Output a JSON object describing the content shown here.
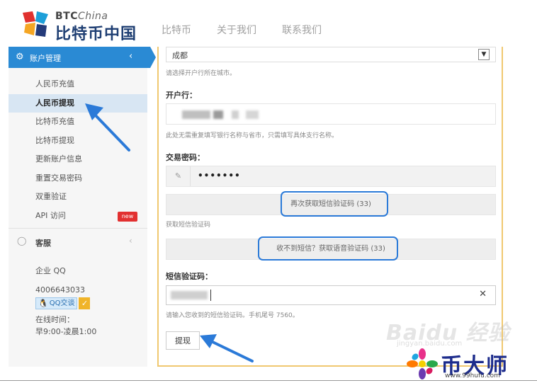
{
  "header": {
    "logo_btc": "BTC",
    "logo_china": "China",
    "logo_cn": "比特币中国",
    "nav": [
      "比特币",
      "关于我们",
      "联系我们"
    ]
  },
  "sidebar": {
    "section_title": "账户管理",
    "items": [
      {
        "label": "人民币充值"
      },
      {
        "label": "人民币提现",
        "active": true
      },
      {
        "label": "比特币充值"
      },
      {
        "label": "比特币提现"
      },
      {
        "label": "更新账户信息"
      },
      {
        "label": "重置交易密码"
      },
      {
        "label": "双重验证"
      },
      {
        "label": "API 访问",
        "badge": "new"
      }
    ],
    "service_title": "客服",
    "service": {
      "qq_label": "企业 QQ",
      "qq_number": "4006643033",
      "qq_button": "QQ交谈",
      "hours_label": "在线时间：",
      "hours": "早9:00-凌晨1:00"
    }
  },
  "form": {
    "city_value": "成都",
    "city_hint": "请选择开户行所在城市。",
    "bank_label": "开户行：",
    "bank_hint": "此处无需重复填写银行名称与省市，只需填写具体支行名称。",
    "password_label": "交易密码：",
    "password_value": "•••••••",
    "resend_sms_button": "再次获取短信验证码 (33)",
    "sms_hint": "获取短信验证码",
    "voice_button": "收不到短信？获取语音验证码 (33)",
    "code_label": "短信验证码：",
    "code_hint": "请输入您收到的短信验证码。手机尾号 7560。",
    "submit_label": "提现"
  },
  "watermarks": {
    "baidu": "Baidu 经验",
    "baidu_sub": "jingyan.baidu.com",
    "brand": "币大师",
    "brand_url": "www.99hufu.com"
  },
  "colors": {
    "accent": "#2a8ad4",
    "highlight": "#2b7ad8",
    "form_border": "#f0c870",
    "badge": "#e23030",
    "brand": "#1d2c8c"
  }
}
